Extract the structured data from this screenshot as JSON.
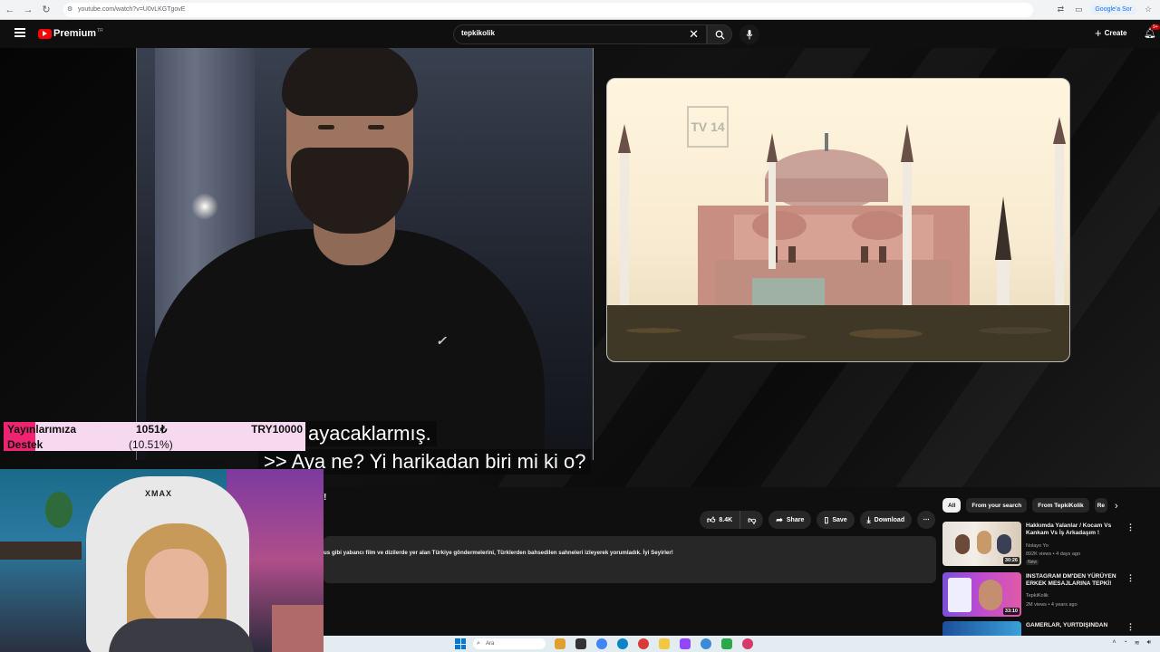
{
  "browser": {
    "url": "youtube.com/watch?v=U0vLKGTgovE",
    "google_sor": "Google'a Sor"
  },
  "header": {
    "logo_text": "Premium",
    "logo_region": "TR",
    "search_value": "tepkikolik",
    "create_label": "Create",
    "notification_count": "9+"
  },
  "video": {
    "subtitle_line1": "ayacaklarmış.",
    "subtitle_line2": ">> Aya ne? Yi harikadan biri mi ki o?",
    "illustration_logo": "TV 14"
  },
  "goal": {
    "label_line1": "Yayınlarımıza",
    "label_line2": "Destek",
    "current": "1051₺",
    "target": "TRY10000",
    "percent": "(10.51%)",
    "fill_fraction": 0.1051
  },
  "streamer": {
    "chair_brand": "XMAX"
  },
  "below_video": {
    "title_fragment": "!",
    "like_count": "8.4K",
    "share_label": "Share",
    "save_label": "Save",
    "download_label": "Download",
    "description": "us gibi yabancı film ve dizilerde yer alan Türkiye göndermelerini, Türklerden bahsedilen sahneleri izleyerek yorumladık. İyi Seyirler!"
  },
  "chips": [
    "All",
    "From your search",
    "From TepkiKolik",
    "Re"
  ],
  "recommendations": [
    {
      "title": "Hakkımda Yalanlar / Kocam Vs Kankam Vs İş Arkadaşım !",
      "channel": "Nolayo Yo",
      "meta": "892K views • 4 days ago",
      "badge": "New",
      "duration": "30:26"
    },
    {
      "title": "INSTAGRAM DM'DEN YÜRÜYEN ERKEK MESAJLARINA TEPKİ!",
      "channel": "TepkiKolik",
      "meta": "2M views • 4 years ago",
      "badge": "",
      "duration": "33:10"
    },
    {
      "title": "GAMERLAR, YURTDIŞINDAN",
      "channel": "",
      "meta": "",
      "badge": "",
      "duration": ""
    }
  ],
  "taskbar": {
    "search_placeholder": "Ara"
  },
  "colors": {
    "yt_red": "#ff0000",
    "goal_fill": "#ee2470",
    "goal_bg": "#f7d9ef"
  }
}
